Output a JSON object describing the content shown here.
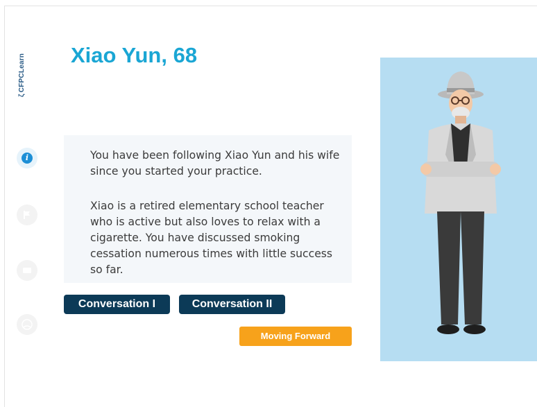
{
  "brand": {
    "logo_text": "CFPCLearn"
  },
  "header": {
    "title": "Xiao Yun, 68"
  },
  "content": {
    "paragraph1": "You have been following Xiao Yun and his wife since you started your practice.",
    "paragraph2": "Xiao is a retired elementary school teacher who is active but also loves to relax with a cigarette. You have discussed smoking cessation numerous times with little success so far."
  },
  "buttons": {
    "conversation1": "Conversation I",
    "conversation2": "Conversation II",
    "moving_forward": "Moving Forward"
  },
  "sidebar": {
    "icons": [
      "info-icon",
      "flag-icon",
      "chat-icon",
      "person-icon"
    ],
    "active_index": 0
  },
  "colors": {
    "title": "#1aa6d4",
    "button_dark": "#0c3a57",
    "button_orange": "#f7a21b",
    "figure_bg": "#b6ddf2",
    "panel_bg": "#f4f7fa"
  }
}
